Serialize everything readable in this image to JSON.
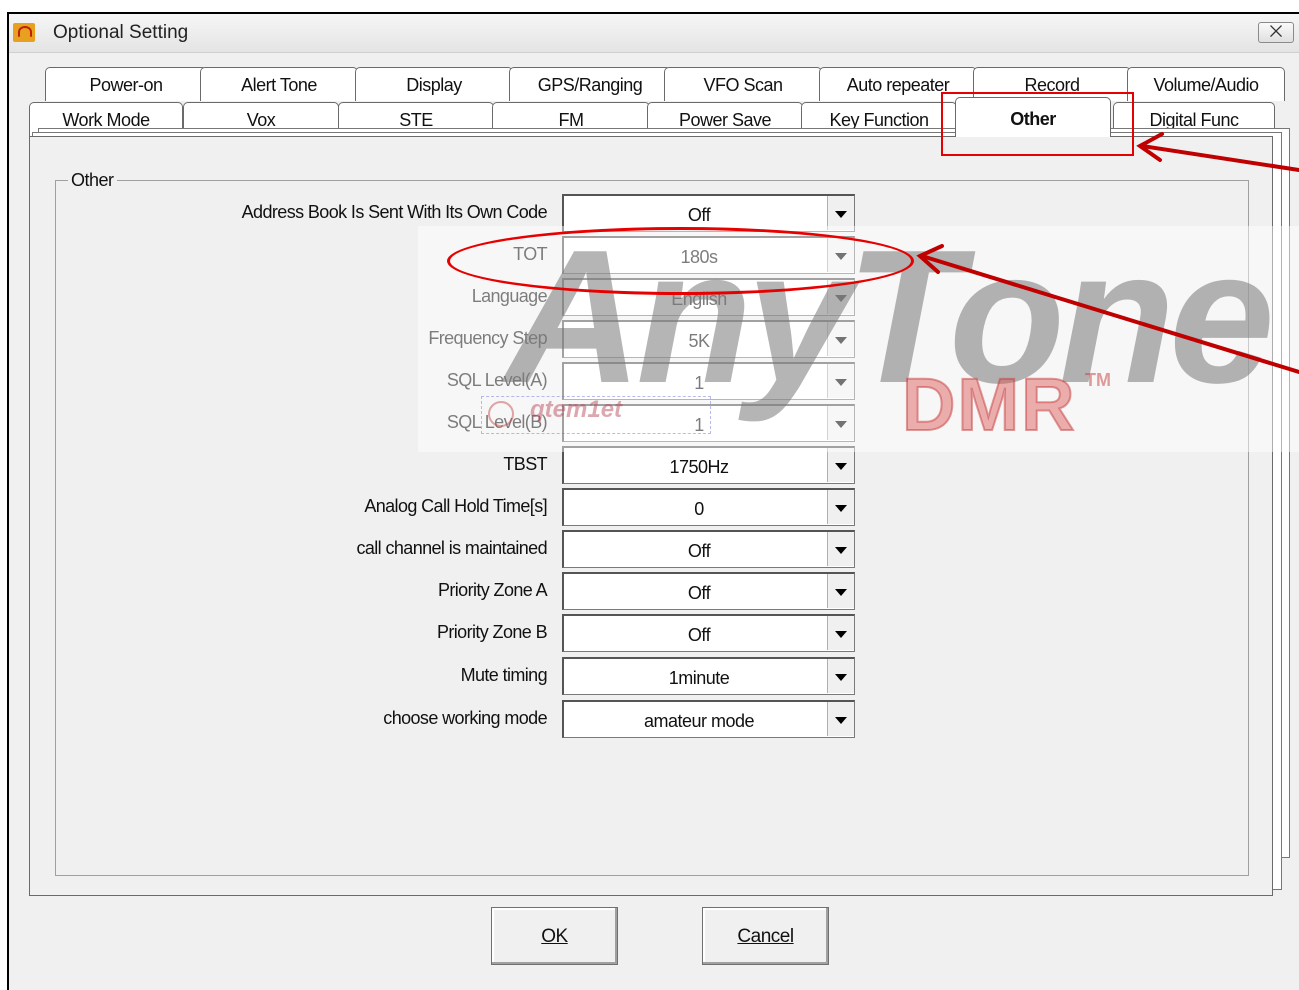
{
  "window": {
    "title": "Optional Setting",
    "close_glyph": "⨉"
  },
  "tabs_back": [
    {
      "label": "Power-on"
    },
    {
      "label": "Alert Tone"
    },
    {
      "label": "Display"
    },
    {
      "label": "GPS/Ranging"
    },
    {
      "label": "VFO Scan"
    },
    {
      "label": "Auto repeater"
    },
    {
      "label": "Record"
    },
    {
      "label": "Volume/Audio"
    }
  ],
  "tabs_front": [
    {
      "label": "Work Mode"
    },
    {
      "label": "Vox"
    },
    {
      "label": "STE"
    },
    {
      "label": "FM"
    },
    {
      "label": "Power Save"
    },
    {
      "label": "Key Function"
    },
    {
      "label": "Other",
      "active": true
    },
    {
      "label": "Digital Func"
    }
  ],
  "group": {
    "label": "Other"
  },
  "settings": [
    {
      "label": "Address Book Is Sent With Its Own Code",
      "value": "Off"
    },
    {
      "label": "TOT",
      "value": "180s"
    },
    {
      "label": "Language",
      "value": "English"
    },
    {
      "label": "Frequency Step",
      "value": "5K"
    },
    {
      "label": "SQL Level(A)",
      "value": "1"
    },
    {
      "label": "SQL Level(B)",
      "value": "1"
    },
    {
      "label": "TBST",
      "value": "1750Hz"
    },
    {
      "label": "Analog Call Hold Time[s]",
      "value": "0"
    },
    {
      "label": "call channel is maintained",
      "value": "Off"
    },
    {
      "label": "Priority Zone A",
      "value": "Off"
    },
    {
      "label": "Priority Zone B",
      "value": "Off"
    },
    {
      "label": "Mute timing",
      "value": "1minute"
    },
    {
      "label": "choose working mode",
      "value": "amateur mode"
    }
  ],
  "buttons": {
    "ok_label": "OK",
    "cancel_label": "Cancel"
  },
  "watermark": {
    "logo": "AnyTone",
    "sub": "DMR",
    "tm": "TM",
    "small": "qtem1et"
  },
  "colors": {
    "annotation": "#e60000"
  }
}
